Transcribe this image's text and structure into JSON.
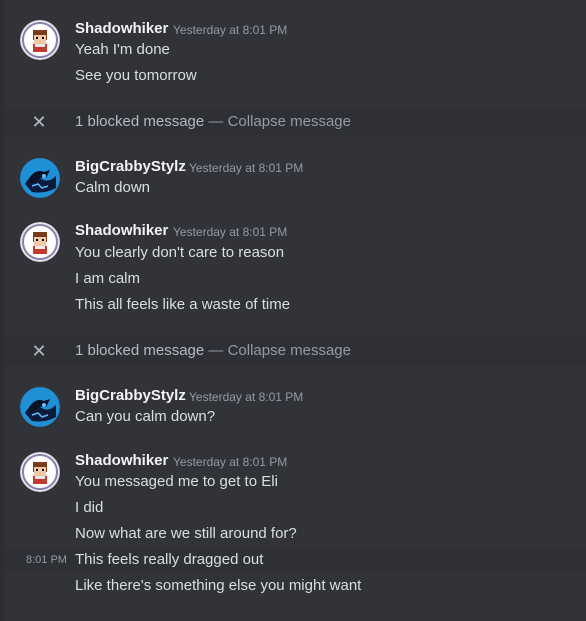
{
  "messages": [
    {
      "author": "Shadowhiker",
      "timestamp": "Yesterday at 8:01 PM",
      "avatar": "shadowhiker-avatar",
      "lines": [
        "Yeah I'm done",
        "See you tomorrow"
      ]
    },
    {
      "blocked": true,
      "count_text": "1 blocked message",
      "separator": "—",
      "action": "Collapse message"
    },
    {
      "author": "BigCrabbyStylz",
      "timestamp": "Yesterday at 8:01 PM",
      "avatar": "bigcrabbystylz-avatar",
      "lines": [
        "Calm down"
      ]
    },
    {
      "author": "Shadowhiker",
      "timestamp": "Yesterday at 8:01 PM",
      "avatar": "shadowhiker-avatar",
      "lines": [
        "You clearly don't care to reason",
        "I am calm",
        "This all feels like a waste of time"
      ]
    },
    {
      "blocked": true,
      "count_text": "1 blocked message",
      "separator": "—",
      "action": "Collapse message"
    },
    {
      "author": "BigCrabbyStylz",
      "timestamp": "Yesterday at 8:01 PM",
      "avatar": "bigcrabbystylz-avatar",
      "lines": [
        "Can you calm down?"
      ]
    },
    {
      "author": "Shadowhiker",
      "timestamp": "Yesterday at 8:01 PM",
      "avatar": "shadowhiker-avatar",
      "lines": [
        "You messaged me to get to Eli",
        "I did",
        "Now what are we still around for?",
        "This feels really dragged out",
        "Like there's something else you might want"
      ],
      "hover_time": "8:01 PM"
    }
  ],
  "colors": {
    "background": "#313338",
    "blocked_bg": "#2e3035",
    "username": "#f2f3f5",
    "text": "#dbdee1",
    "muted": "#949ba4"
  }
}
